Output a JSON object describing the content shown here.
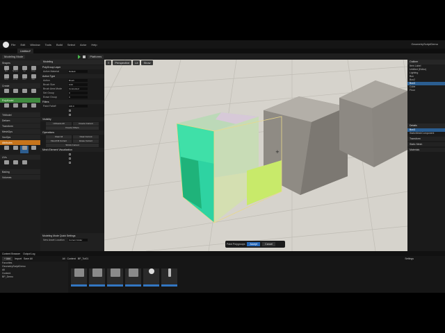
{
  "menu": {
    "items": [
      "File",
      "Edit",
      "Window",
      "Tools",
      "Build",
      "Select",
      "Actor",
      "Help"
    ],
    "project": "GeometryScriptDemo"
  },
  "tab": {
    "label": "Untitled*"
  },
  "toolbar": {
    "mode": "Modeling Mode",
    "platforms": "Platforms"
  },
  "left_panel": {
    "shapes_label": "Shapes",
    "tools": [
      "Box",
      "Sphere",
      "Cyl",
      "Cone",
      "Torus",
      "Arrow",
      "Rect",
      "Disc",
      "Stairs",
      "Capsule"
    ],
    "categories": [
      "Create",
      "PolyModel",
      "TriModel",
      "Deform",
      "Transform",
      "MeshOps",
      "VoxOps",
      "Attributes",
      "UVs",
      "Baking",
      "Volumes",
      "LODs"
    ]
  },
  "props_panel": {
    "title": "Modeling",
    "rows": [
      {
        "label": "Active Material",
        "value": "Default"
      },
      {
        "label": "Action",
        "value": "Brush"
      },
      {
        "label": "Brush Size",
        "value": "0.00"
      },
      {
        "label": "Brush Area Mode",
        "value": "Connected"
      },
      {
        "label": "Set Group",
        "value": "0"
      },
      {
        "label": "Erase Group",
        "value": "0"
      },
      {
        "label": "Paint Falloff",
        "value": "100.0"
      }
    ],
    "sections": [
      "PolyGroup Layer",
      "Action Type",
      "Filters",
      "Visibility",
      "Operations",
      "Mesh Element Visualization"
    ],
    "buttons": [
      "Unfreeze All",
      "Freeze Current",
      "Freeze Others",
      "Clear All",
      "Clear Current",
      "Flood Fill Current",
      "Erase Current",
      "Shrink Current"
    ],
    "quick": {
      "title": "Modeling Mode Quick Settings",
      "label": "New Asset Location",
      "value": "Current Folder"
    }
  },
  "viewport": {
    "perspective": "Perspective",
    "lit": "Lit",
    "show": "Show"
  },
  "accept_bar": {
    "label": "Paint Polygroups",
    "accept": "Accept",
    "cancel": "Cancel"
  },
  "outliner": {
    "title": "Outliner",
    "rows": [
      "Item Label",
      "Untitled (Editor)",
      "Lighting",
      "Box",
      "Box2",
      "Box3",
      "Cube",
      "Floor"
    ]
  },
  "details": {
    "title": "Details",
    "object": "Box3",
    "component": "StaticMeshComponent",
    "sections": [
      "Transform",
      "Static Mesh",
      "Materials"
    ]
  },
  "content_browser": {
    "tabs": [
      "Content Browser",
      "Output Log"
    ],
    "add": "+ Add",
    "import": "Import",
    "save_all": "Save All",
    "path": [
      "All",
      "Content",
      "BP_Tut01"
    ],
    "settings": "Settings",
    "favorites": "Favorites",
    "project": "GeometryScriptDemo",
    "tree": [
      "All",
      "Content",
      "BP_Demo",
      "BP_ModelingUtil"
    ],
    "assets": 6
  }
}
